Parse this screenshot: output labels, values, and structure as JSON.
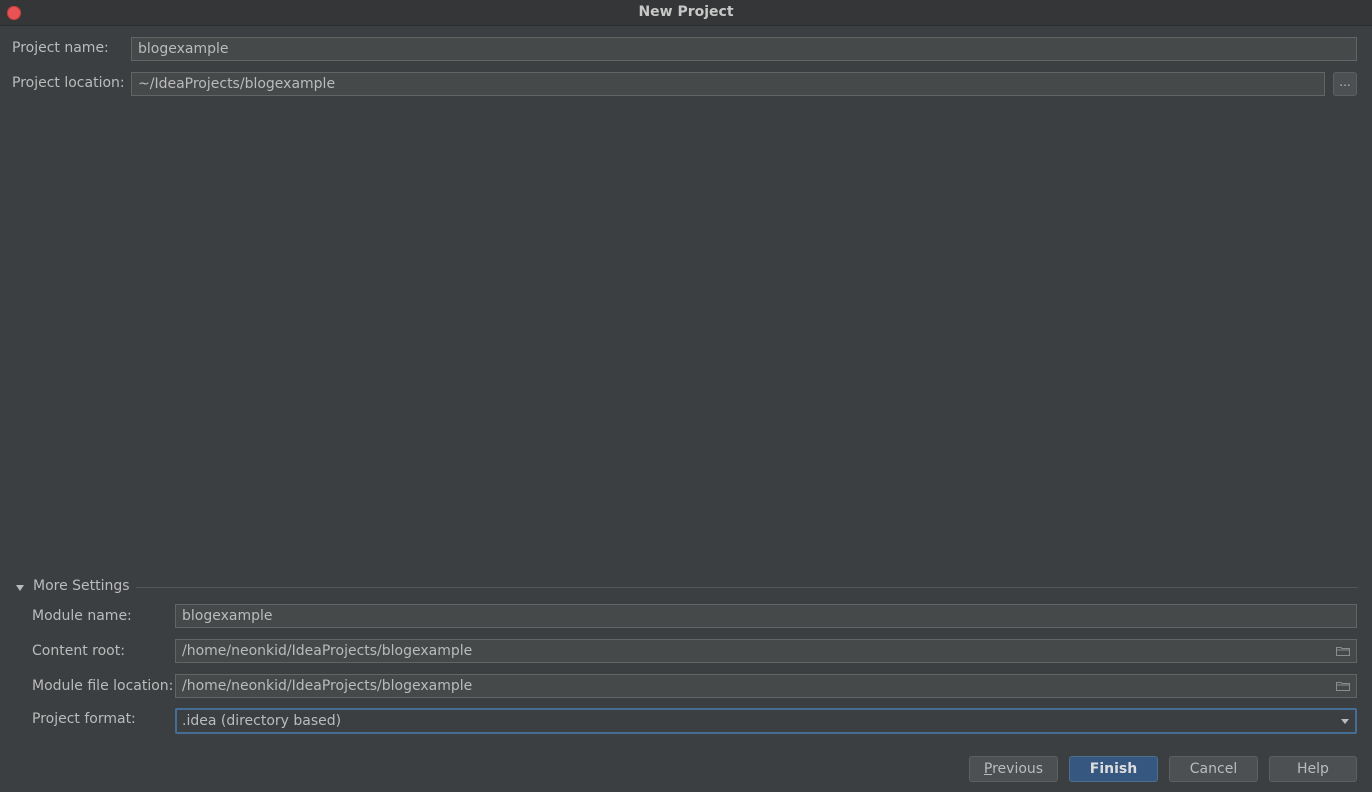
{
  "window": {
    "title": "New Project"
  },
  "project": {
    "name_label": "Project name:",
    "name_value": "blogexample",
    "location_label": "Project location:",
    "location_value": "~/IdeaProjects/blogexample",
    "browse_label": "..."
  },
  "more_settings": {
    "label": "More Settings",
    "module_name_label": "Module name:",
    "module_name_value": "blogexample",
    "content_root_label": "Content root:",
    "content_root_value": "/home/neonkid/IdeaProjects/blogexample",
    "module_file_label": "Module file location:",
    "module_file_value": "/home/neonkid/IdeaProjects/blogexample",
    "format_label": "Project format:",
    "format_value": ".idea (directory based)"
  },
  "buttons": {
    "previous": "Previous",
    "finish": "Finish",
    "cancel": "Cancel",
    "help": "Help"
  },
  "icons": {
    "close": "close-icon",
    "triangle": "chevron-down-icon",
    "folder": "folder-icon",
    "combo_arrow": "dropdown-arrow-icon"
  },
  "colors": {
    "accent": "#466d94",
    "primary_button": "#365880",
    "close_button": "#e95356"
  }
}
